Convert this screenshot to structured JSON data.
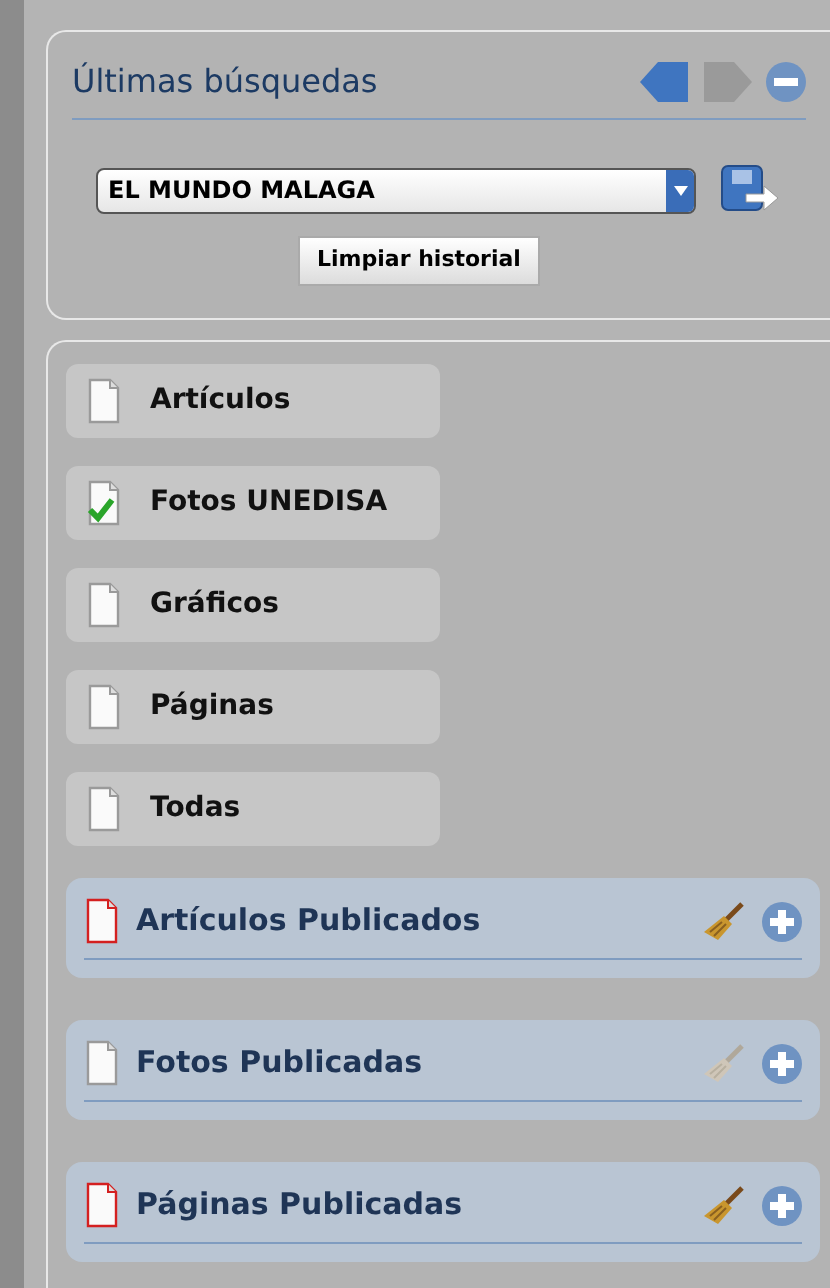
{
  "history": {
    "title": "Últimas búsquedas",
    "back_enabled": true,
    "forward_enabled": false,
    "select_value": "EL MUNDO MALAGA",
    "clear_button": "Limpiar historial"
  },
  "categories": [
    {
      "label": "Artículos",
      "checked": false
    },
    {
      "label": "Fotos UNEDISA",
      "checked": true
    },
    {
      "label": "Gráficos",
      "checked": false
    },
    {
      "label": "Páginas",
      "checked": false
    },
    {
      "label": "Todas",
      "checked": false
    }
  ],
  "published": [
    {
      "label": "Artículos Publicados",
      "highlighted": true,
      "clear_enabled": true
    },
    {
      "label": "Fotos Publicadas",
      "highlighted": false,
      "clear_enabled": false
    },
    {
      "label": "Páginas Publicadas",
      "highlighted": true,
      "clear_enabled": true
    }
  ]
}
